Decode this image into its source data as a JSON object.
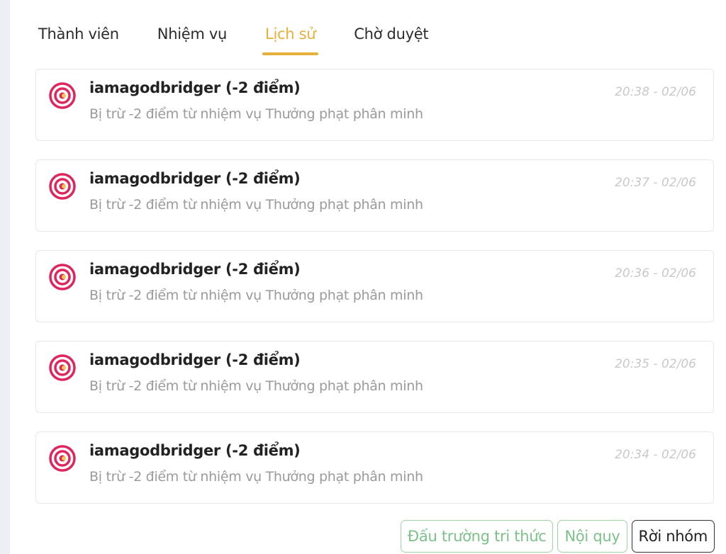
{
  "tabs": [
    {
      "label": "Thành viên",
      "active": false
    },
    {
      "label": "Nhiệm vụ",
      "active": false
    },
    {
      "label": "Lịch sử",
      "active": true
    },
    {
      "label": "Chờ duyệt",
      "active": false
    }
  ],
  "history": [
    {
      "title": "iamagodbridger (-2 điểm)",
      "desc": "Bị trừ -2 điểm từ nhiệm vụ Thưởng phạt phân minh",
      "time": "20:38 - 02/06",
      "icon": "target-icon"
    },
    {
      "title": "iamagodbridger (-2 điểm)",
      "desc": "Bị trừ -2 điểm từ nhiệm vụ Thưởng phạt phân minh",
      "time": "20:37 - 02/06",
      "icon": "target-icon"
    },
    {
      "title": "iamagodbridger (-2 điểm)",
      "desc": "Bị trừ -2 điểm từ nhiệm vụ Thưởng phạt phân minh",
      "time": "20:36 - 02/06",
      "icon": "target-icon"
    },
    {
      "title": "iamagodbridger (-2 điểm)",
      "desc": "Bị trừ -2 điểm từ nhiệm vụ Thưởng phạt phân minh",
      "time": "20:35 - 02/06",
      "icon": "target-icon"
    },
    {
      "title": "iamagodbridger (-2 điểm)",
      "desc": "Bị trừ -2 điểm từ nhiệm vụ Thưởng phạt phân minh",
      "time": "20:34 - 02/06",
      "icon": "target-icon"
    }
  ],
  "footer": {
    "arena_label": "Đấu trường tri thức",
    "rules_label": "Nội quy",
    "leave_label": "Rời nhóm"
  },
  "colors": {
    "accent": "#e6b03a",
    "icon_primary": "#e0245e",
    "button_green": "#7cc189"
  }
}
